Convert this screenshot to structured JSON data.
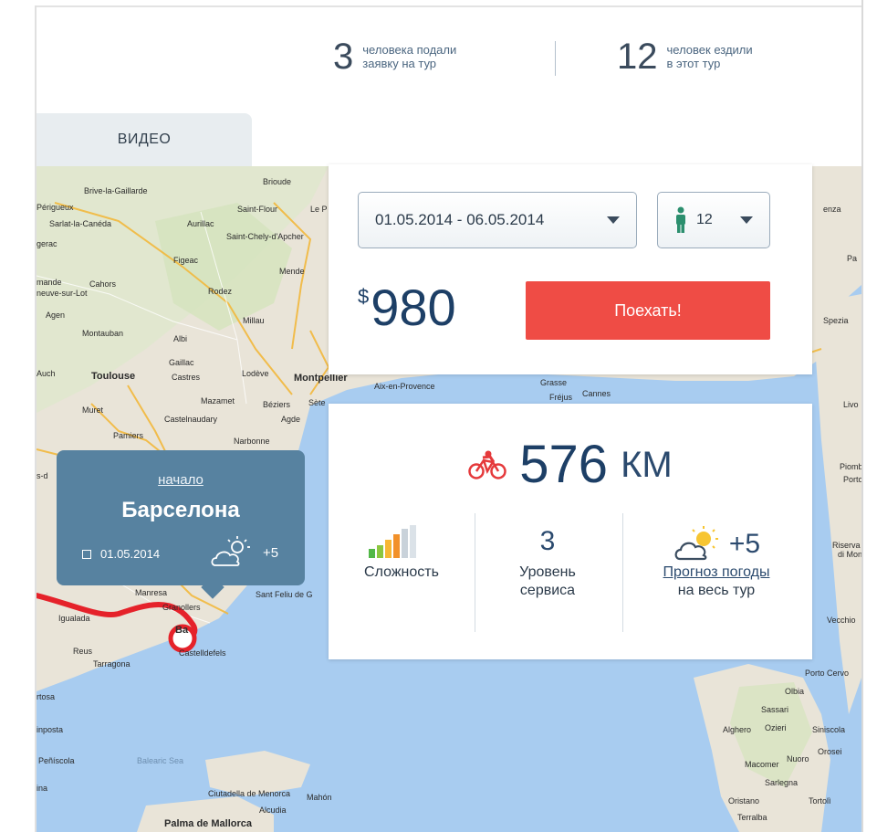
{
  "stats": {
    "applied": {
      "number": "3",
      "line1": "человека подали",
      "line2": "заявку на тур"
    },
    "traveled": {
      "number": "12",
      "line1": "человек ездили",
      "line2": "в этот тур"
    }
  },
  "tabs": [
    {
      "label": "ВИДЕО"
    }
  ],
  "booking": {
    "dates": "01.05.2014 - 06.05.2014",
    "people": "12",
    "currency": "$",
    "price": "980",
    "go_label": "Поехать!"
  },
  "info": {
    "distance": "576",
    "distance_unit": "КМ",
    "difficulty_label": "Сложность",
    "difficulty_level": 0.6,
    "service_value": "3",
    "service_line1": "Уровень",
    "service_line2": "сервиса",
    "weather_value": "+5",
    "weather_link": "Прогноз погоды",
    "weather_line2": "на весь тур"
  },
  "tooltip": {
    "start_label": "начало",
    "city": "Барселона",
    "date": "01.05.2014",
    "temp": "+5"
  },
  "map": {
    "places": [
      {
        "name": "Brive-la-Gaillarde",
        "id": "p1"
      },
      {
        "name": "Périgueux",
        "id": "p2"
      },
      {
        "name": "Sarlat-la-Canéda",
        "id": "p3"
      },
      {
        "name": "Aurillac",
        "id": "p4"
      },
      {
        "name": "Saint-Flour",
        "id": "p5"
      },
      {
        "name": "Brioude",
        "id": "p6"
      },
      {
        "name": "Le P",
        "id": "p7"
      },
      {
        "name": "Saint-Chely-d'Apcher",
        "id": "p8"
      },
      {
        "name": "gerac",
        "id": "p9"
      },
      {
        "name": "Figeac",
        "id": "p10"
      },
      {
        "name": "Mende",
        "id": "p11"
      },
      {
        "name": "mande",
        "id": "p12"
      },
      {
        "name": "neuve-sur-Lot",
        "id": "p13"
      },
      {
        "name": "Cahors",
        "id": "p14"
      },
      {
        "name": "Rodez",
        "id": "p15"
      },
      {
        "name": "Agen",
        "id": "p16"
      },
      {
        "name": "Millau",
        "id": "p17"
      },
      {
        "name": "Montauban",
        "id": "p18"
      },
      {
        "name": "Albi",
        "id": "p19"
      },
      {
        "name": "Gaillac",
        "id": "p20"
      },
      {
        "name": "Auch",
        "id": "p21"
      },
      {
        "name": "Toulouse",
        "id": "p22"
      },
      {
        "name": "Castres",
        "id": "p23"
      },
      {
        "name": "Lodève",
        "id": "p24"
      },
      {
        "name": "Montpellier",
        "id": "p25"
      },
      {
        "name": "Mazamet",
        "id": "p26"
      },
      {
        "name": "Béziers",
        "id": "p27"
      },
      {
        "name": "Sète",
        "id": "p28"
      },
      {
        "name": "Muret",
        "id": "p29"
      },
      {
        "name": "Castelnaudary",
        "id": "p30"
      },
      {
        "name": "Agde",
        "id": "p31"
      },
      {
        "name": "Pamiers",
        "id": "p32"
      },
      {
        "name": "Narbonne",
        "id": "p33"
      },
      {
        "name": "Aix-en-Provence",
        "id": "p34"
      },
      {
        "name": "Grasse",
        "id": "p35"
      },
      {
        "name": "Fréjus",
        "id": "p36"
      },
      {
        "name": "Cannes",
        "id": "p37"
      },
      {
        "name": "Igualada",
        "id": "p38"
      },
      {
        "name": "Granollers",
        "id": "p39"
      },
      {
        "name": "Sant Feliu de G",
        "id": "p40"
      },
      {
        "name": "Manresa",
        "id": "p41"
      },
      {
        "name": "Reus",
        "id": "p42"
      },
      {
        "name": "Tarragona",
        "id": "p43"
      },
      {
        "name": "Castelldefels",
        "id": "p44"
      },
      {
        "name": "Peñíscola",
        "id": "p45"
      },
      {
        "name": "Balearic Sea",
        "id": "p46"
      },
      {
        "name": "Ciutadella de Menorca",
        "id": "p47"
      },
      {
        "name": "Mahón",
        "id": "p48"
      },
      {
        "name": "Alcudia",
        "id": "p49"
      },
      {
        "name": "Palma de Mallorca",
        "id": "p50"
      },
      {
        "name": "Sassari",
        "id": "p51"
      },
      {
        "name": "Alghero",
        "id": "p52"
      },
      {
        "name": "Ozieri",
        "id": "p53"
      },
      {
        "name": "Siniscola",
        "id": "p54"
      },
      {
        "name": "Olbia",
        "id": "p55"
      },
      {
        "name": "Porto Cervo",
        "id": "p56"
      },
      {
        "name": "Macomer",
        "id": "p57"
      },
      {
        "name": "Nuoro",
        "id": "p58"
      },
      {
        "name": "Orosei",
        "id": "p59"
      },
      {
        "name": "Sarlegna",
        "id": "p60"
      },
      {
        "name": "Oristano",
        "id": "p61"
      },
      {
        "name": "Tortolì",
        "id": "p62"
      },
      {
        "name": "Terralba",
        "id": "p63"
      },
      {
        "name": "Spezia",
        "id": "p64"
      },
      {
        "name": "Piomb",
        "id": "p65"
      },
      {
        "name": "Porto",
        "id": "p66"
      },
      {
        "name": "Riserva S",
        "id": "p67"
      },
      {
        "name": "di Mon",
        "id": "p68"
      },
      {
        "name": "Vecchio",
        "id": "p69"
      },
      {
        "name": "Livo",
        "id": "p70"
      },
      {
        "name": "enza",
        "id": "p71"
      },
      {
        "name": "Pa",
        "id": "p72"
      },
      {
        "name": "rtosa",
        "id": "p73"
      },
      {
        "name": "inposta",
        "id": "p74"
      },
      {
        "name": "ina",
        "id": "p75"
      },
      {
        "name": "Ba",
        "id": "p76"
      },
      {
        "name": "s-d",
        "id": "p77"
      }
    ]
  }
}
